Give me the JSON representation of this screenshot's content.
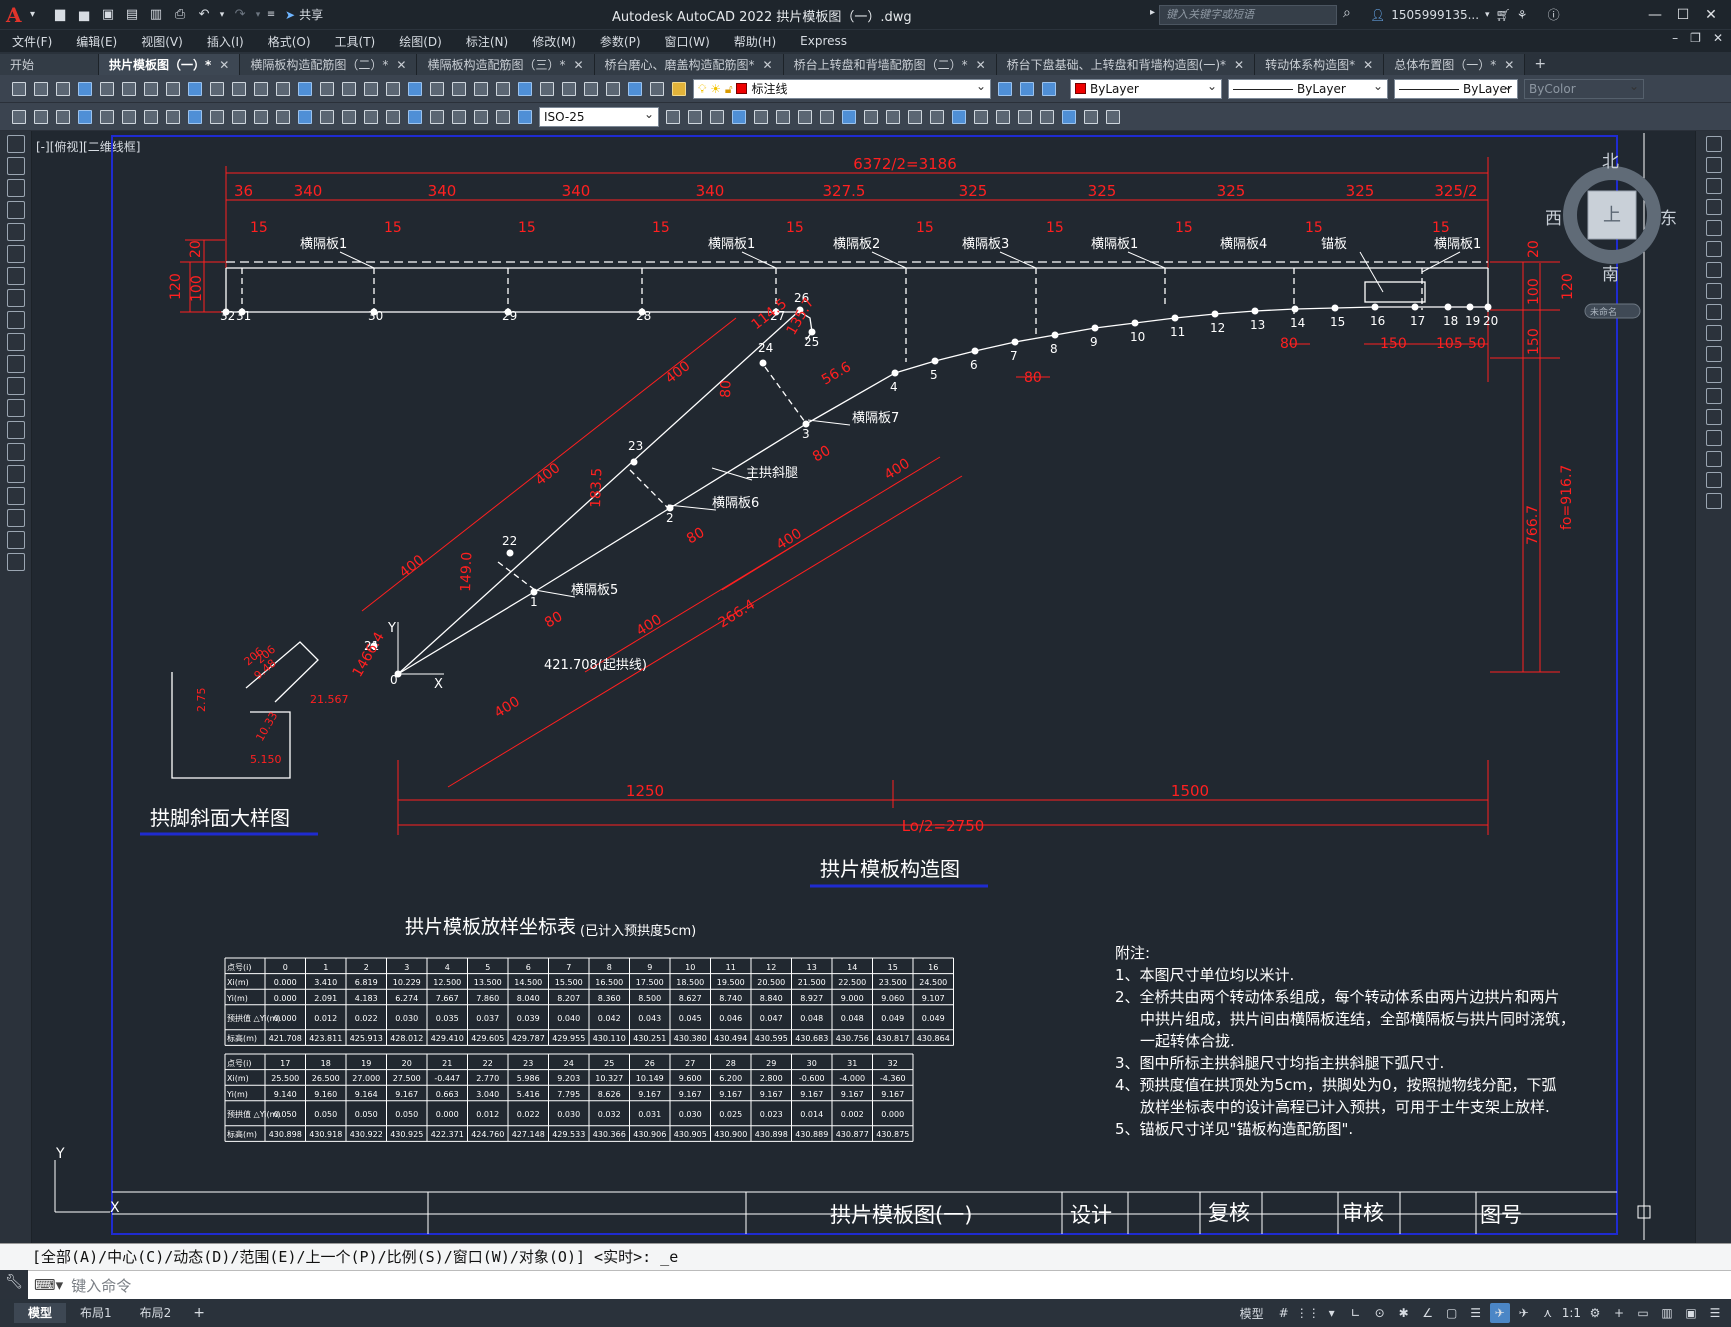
{
  "app": {
    "title": "Autodesk AutoCAD 2022    拱片模板图（一）.dwg",
    "share": "共享",
    "search_placeholder": "键入关键字或短语",
    "user": "1505999135..."
  },
  "menu": [
    "文件(F)",
    "编辑(E)",
    "视图(V)",
    "插入(I)",
    "格式(O)",
    "工具(T)",
    "绘图(D)",
    "标注(N)",
    "修改(M)",
    "参数(P)",
    "窗口(W)",
    "帮助(H)",
    "Express"
  ],
  "tabs": [
    {
      "label": "开始",
      "active": false
    },
    {
      "label": "拱片模板图（一）*",
      "active": true
    },
    {
      "label": "横隔板构造配筋图（二）*",
      "active": false
    },
    {
      "label": "横隔板构造配筋图（三）*",
      "active": false
    },
    {
      "label": "桥台磨心、磨盖构造配筋图*",
      "active": false
    },
    {
      "label": "桥台上转盘和背墙配筋图（二）*",
      "active": false
    },
    {
      "label": "桥台下盘基础、上转盘和背墙构造图(一)*",
      "active": false
    },
    {
      "label": "转动体系构造图*",
      "active": false
    },
    {
      "label": "总体布置图（一）*",
      "active": false
    }
  ],
  "toolbar": {
    "layer": "标注线",
    "color": "ByLayer",
    "linetype": "ByLayer",
    "lineweight": "ByLayer",
    "plotstyle": "ByColor",
    "dimstyle": "ISO-25"
  },
  "viewport_label": "[-][俯视][二维线框]",
  "viewcube": {
    "north": "北",
    "south": "南",
    "east": "东",
    "west": "西",
    "top": "上",
    "wcs": "未命名"
  },
  "drawing": {
    "overall_dim": "6372/2=3186",
    "top_dims": [
      "36",
      "340",
      "340",
      "340",
      "340",
      "327.5",
      "325",
      "325",
      "325",
      "325",
      "325/2"
    ],
    "small_dims": [
      "15",
      "15",
      "15",
      "15",
      "15",
      "15",
      "15",
      "15",
      "15",
      "15"
    ],
    "left_dims": [
      "20",
      "120",
      "100"
    ],
    "right_dims": [
      "20",
      "100",
      "120",
      "150",
      "766.7",
      "fo=916.7"
    ],
    "panel_labels": [
      "横隔板1",
      "横隔板1",
      "横隔板2",
      "横隔板3",
      "横隔板1",
      "横隔板4",
      "锚板",
      "横隔板1",
      "横隔板7",
      "主拱斜腿",
      "横隔板6",
      "横隔板5"
    ],
    "points_top": [
      "32",
      "31",
      "30",
      "29",
      "28",
      "27",
      "26"
    ],
    "points_arch": [
      "4",
      "5",
      "6",
      "7",
      "8",
      "9",
      "10",
      "11",
      "12",
      "13",
      "14",
      "15",
      "16",
      "17",
      "18",
      "19",
      "20"
    ],
    "points_leg": [
      "0",
      "1",
      "2",
      "3",
      "21",
      "22",
      "23",
      "24",
      "25"
    ],
    "bottom_right_dims": [
      "80",
      "150",
      "105",
      "50",
      "80"
    ],
    "leg_dims": [
      "400",
      "400",
      "400",
      "400",
      "400",
      "400",
      "400",
      "266.4",
      "1466.4",
      "80",
      "80",
      "80",
      "80",
      "183.5",
      "149.0",
      "114.5",
      "135.7",
      "56.6",
      "80"
    ],
    "spring_label": "421.708(起拱线)",
    "span_dims": [
      "1250",
      "1500",
      "Lo/2=2750"
    ],
    "main_title": "拱片模板构造图",
    "detail_title": "拱脚斜面大样图",
    "detail_dims": [
      "2.75",
      "9.48",
      "10.33",
      "5.150",
      "21.567",
      "206",
      "206"
    ],
    "axis_y": "Y",
    "axis_x": "X"
  },
  "table": {
    "title": "拱片模板放样坐标表",
    "title_note": "(已计入预拱度5cm)",
    "row_labels": [
      "点号(i)",
      "Xi(m)",
      "Yi(m)",
      "预拱值 △Yi(m)",
      "标高(m)"
    ],
    "part1": {
      "ids": [
        "0",
        "1",
        "2",
        "3",
        "4",
        "5",
        "6",
        "7",
        "8",
        "9",
        "10",
        "11",
        "12",
        "13",
        "14",
        "15",
        "16"
      ],
      "x": [
        "0.000",
        "3.410",
        "6.819",
        "10.229",
        "12.500",
        "13.500",
        "14.500",
        "15.500",
        "16.500",
        "17.500",
        "18.500",
        "19.500",
        "20.500",
        "21.500",
        "22.500",
        "23.500",
        "24.500"
      ],
      "y": [
        "0.000",
        "2.091",
        "4.183",
        "6.274",
        "7.667",
        "7.860",
        "8.040",
        "8.207",
        "8.360",
        "8.500",
        "8.627",
        "8.740",
        "8.840",
        "8.927",
        "9.000",
        "9.060",
        "9.107"
      ],
      "dy": [
        "0.000",
        "0.012",
        "0.022",
        "0.030",
        "0.035",
        "0.037",
        "0.039",
        "0.040",
        "0.042",
        "0.043",
        "0.045",
        "0.046",
        "0.047",
        "0.048",
        "0.048",
        "0.049",
        "0.049"
      ],
      "elev": [
        "421.708",
        "423.811",
        "425.913",
        "428.012",
        "429.410",
        "429.605",
        "429.787",
        "429.955",
        "430.110",
        "430.251",
        "430.380",
        "430.494",
        "430.595",
        "430.683",
        "430.756",
        "430.817",
        "430.864"
      ]
    },
    "part2": {
      "ids": [
        "17",
        "18",
        "19",
        "20",
        "21",
        "22",
        "23",
        "24",
        "25",
        "26",
        "27",
        "28",
        "29",
        "30",
        "31",
        "32"
      ],
      "x": [
        "25.500",
        "26.500",
        "27.000",
        "27.500",
        "-0.447",
        "2.770",
        "5.986",
        "9.203",
        "10.327",
        "10.149",
        "9.600",
        "6.200",
        "2.800",
        "-0.600",
        "-4.000",
        "-4.360"
      ],
      "y": [
        "9.140",
        "9.160",
        "9.164",
        "9.167",
        "0.663",
        "3.040",
        "5.416",
        "7.795",
        "8.626",
        "9.167",
        "9.167",
        "9.167",
        "9.167",
        "9.167",
        "9.167",
        "9.167"
      ],
      "dy": [
        "0.050",
        "0.050",
        "0.050",
        "0.050",
        "0.000",
        "0.012",
        "0.022",
        "0.030",
        "0.032",
        "0.031",
        "0.030",
        "0.025",
        "0.023",
        "0.014",
        "0.002",
        "0.000"
      ],
      "elev": [
        "430.898",
        "430.918",
        "430.922",
        "430.925",
        "422.371",
        "424.760",
        "427.148",
        "429.533",
        "430.366",
        "430.906",
        "430.905",
        "430.900",
        "430.898",
        "430.889",
        "430.877",
        "430.875"
      ]
    }
  },
  "notes": [
    "附注:",
    "1、本图尺寸单位均以米计.",
    "2、全桥共由两个转动体系组成，每个转动体系由两片边拱片和两片",
    "中拱片组成，拱片间由横隔板连结，全部横隔板与拱片同时浇筑，",
    "一起转体合拢.",
    "3、图中所标主拱斜腿尺寸均指主拱斜腿下弧尺寸.",
    "4、预拱度值在拱顶处为5cm，拱脚处为0，按照抛物线分配，下弧",
    "放样坐标表中的设计高程已计入预拱，可用于土牛支架上放样.",
    "5、锚板尺寸详见\"锚板构造配筋图\"."
  ],
  "titleblock": {
    "name": "拱片模板图(一)",
    "design": "设计",
    "check": "复核",
    "review": "审核",
    "number": "图号"
  },
  "command": {
    "prompt": "[全部(A)/中心(C)/动态(D)/范围(E)/上一个(P)/比例(S)/窗口(W)/对象(O)] <实时>: _e",
    "input_placeholder": "键入命令"
  },
  "status": {
    "tabs": [
      "模型",
      "布局1",
      "布局2"
    ],
    "model": "模型",
    "scale": "1:1"
  },
  "colors": {
    "dim": "#ff2020",
    "geom": "#ffffff",
    "border": "#1f2bd0",
    "bg": "#212830"
  }
}
